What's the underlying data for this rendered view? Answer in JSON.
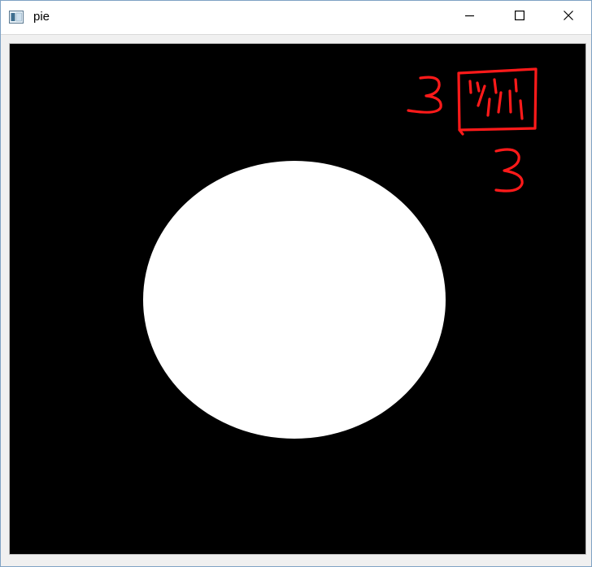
{
  "window": {
    "title": "pie",
    "app_icon": "window-app-icon",
    "controls": {
      "minimize_icon": "minimize-icon",
      "maximize_icon": "maximize-icon",
      "close_icon": "close-icon"
    }
  },
  "canvas": {
    "background_color": "#000000",
    "shape": "circle",
    "shape_color": "#ffffff",
    "annotation_color": "#ff0000"
  }
}
